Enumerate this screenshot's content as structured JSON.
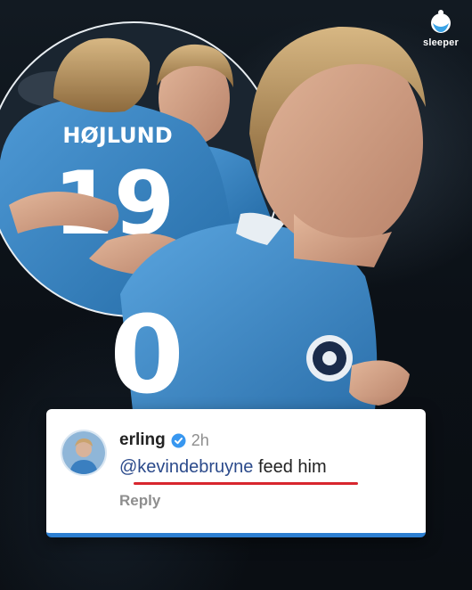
{
  "brand": {
    "name": "sleeper",
    "logo_icon": "sleeper-logo-icon"
  },
  "photo": {
    "inset_jersey_name": "HØJLUND",
    "inset_jersey_number": "19",
    "main_jersey_number": "0"
  },
  "comment": {
    "username": "erling",
    "verified_icon": "verified-badge-icon",
    "time": "2h",
    "mention": "@kevindebruyne",
    "text": " feed him",
    "reply_label": "Reply",
    "highlight_color": "#d8262e",
    "accent_color": "#2d7fd1"
  }
}
